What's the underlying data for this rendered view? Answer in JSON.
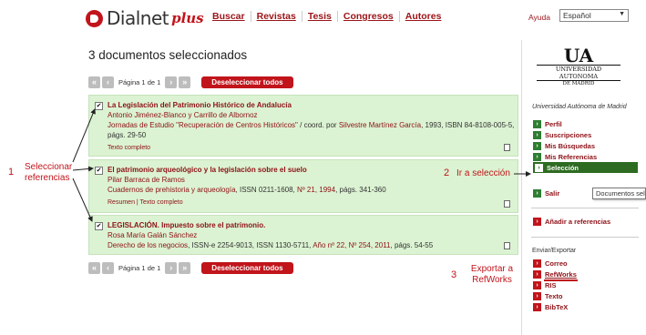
{
  "header": {
    "logo_text": "Dialnet",
    "logo_plus": "plus",
    "nav": [
      "Buscar",
      "Revistas",
      "Tesis",
      "Congresos",
      "Autores"
    ],
    "help": "Ayuda",
    "language": "Español"
  },
  "main": {
    "title": "3 documentos seleccionados",
    "pager": {
      "page_text": "Página 1 de 1",
      "deselect_label": "Deseleccionar todos"
    },
    "results": [
      {
        "checked": "✔",
        "title": "La Legislación del Patrimonio Histórico de Andalucía",
        "authors": "Antonio Jiménez-Blanco y Carrillo de Albornoz",
        "source_prefix": "Jornadas de Estudio \"Recuperación de Centros Históricos\"",
        "source_mid": " / coord. por ",
        "source_coord": "Silvestre Martínez García",
        "source_rest": ", 1993, ISBN 84-8108-005-5, págs. 29-50",
        "footer": "Texto completo"
      },
      {
        "checked": "✔",
        "title": "El patrimonio arqueológico y la legislación sobre el suelo",
        "authors": "Pilar Barraca de Ramos",
        "source_prefix": "Cuadernos de prehistoria y arqueología",
        "source_mid": ", ISSN 0211-1608, ",
        "source_coord": "Nº 21, 1994",
        "source_rest": ", págs. 341-360",
        "footer": "Resumen | Texto completo"
      },
      {
        "checked": "✔",
        "title": "LEGISLACIÓN. Impuesto sobre el patrimonio.",
        "authors": "Rosa María Galán Sánchez",
        "source_prefix": "Derecho de los negocios",
        "source_mid": ", ISSN-e 2254-9013, ISSN 1130-5711, ",
        "source_coord": "Año nº 22, Nº 254, 2011",
        "source_rest": ", págs. 54-55",
        "footer": ""
      }
    ]
  },
  "sidebar": {
    "logo_big": "UA",
    "logo_line1": "UNIVERSIDAD AUTONOMA",
    "logo_line2": "DE MADRID",
    "university": "Universidad Autónoma de Madrid",
    "links": [
      "Perfil",
      "Suscripciones",
      "Mis Búsquedas",
      "Mis Referencias",
      "Selección",
      "Salir"
    ],
    "add_refs": "Añadir a referencias",
    "export_title": "Enviar/Exportar",
    "export": [
      "Correo",
      "RefWorks",
      "RIS",
      "Texto",
      "BibTeX"
    ],
    "tooltip": "Documentos sel"
  },
  "annotations": {
    "n1": "1",
    "label1": "Seleccionar referencias",
    "n2": "2",
    "label2": "Ir a selección",
    "n3": "3",
    "label3": "Exportar a RefWorks"
  },
  "colors": {
    "brand_red": "#c1141b",
    "result_bg": "#dbf3d2",
    "active_green": "#2e6b22"
  }
}
